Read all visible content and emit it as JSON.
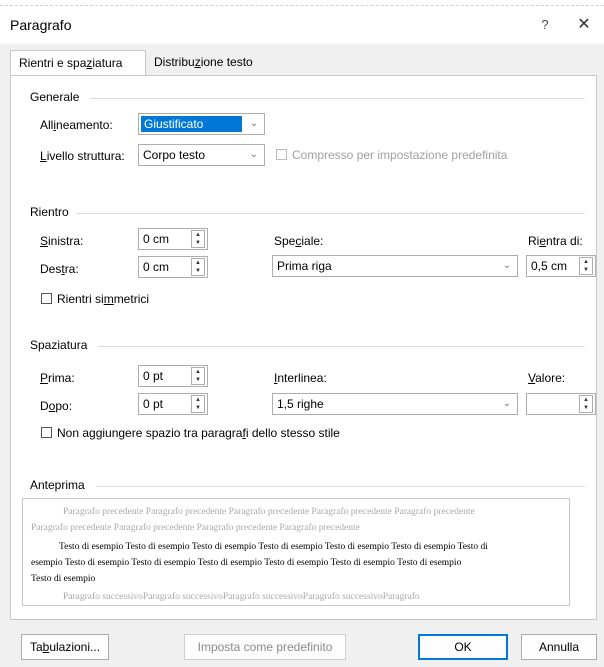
{
  "window": {
    "title": "Paragrafo",
    "help": "?",
    "close": "✕"
  },
  "tabs": [
    {
      "label_pre": "Rientri e spa",
      "label_u": "z",
      "label_post": "iatura"
    },
    {
      "label_pre": "Distribu",
      "label_u": "z",
      "label_post": "ione testo"
    }
  ],
  "generale": {
    "title": "Generale",
    "allineamento_pre": "All",
    "allineamento_u": "i",
    "allineamento_post": "neamento:",
    "allineamento_value": "Giustificato",
    "livello_u": "L",
    "livello_post": "ivello struttura:",
    "livello_value": "Corpo testo",
    "compresso": "Compresso per impostazione predefinita"
  },
  "rientro": {
    "title": "Rientro",
    "sinistra_u": "S",
    "sinistra_post": "inistra:",
    "sinistra_value": "0 cm",
    "destra_pre": "Des",
    "destra_u": "t",
    "destra_post": "ra:",
    "destra_value": "0 cm",
    "speciale_pre": "Spe",
    "speciale_u": "c",
    "speciale_post": "iale:",
    "speciale_value": "Prima riga",
    "rientradi_pre": "Ri",
    "rientradi_u": "e",
    "rientradi_post": "ntra di:",
    "rientradi_value": "0,5 cm",
    "simmetrici_pre": "Rientri si",
    "simmetrici_u": "m",
    "simmetrici_post": "metrici"
  },
  "spaziatura": {
    "title": "Spaziatura",
    "prima_u": "P",
    "prima_post": "rima:",
    "prima_value": "0 pt",
    "dopo_pre": "D",
    "dopo_u": "o",
    "dopo_post": "po:",
    "dopo_value": "0 pt",
    "interlinea_u": "I",
    "interlinea_post": "nterlinea:",
    "interlinea_value": "1,5 righe",
    "valore_u": "V",
    "valore_post": "alore:",
    "valore_value": "",
    "non_aggiungere_pre": "Non aggiungere spazio tra paragra",
    "non_aggiungere_u": "f",
    "non_aggiungere_post": "i dello stesso stile"
  },
  "anteprima": {
    "title": "Anteprima",
    "prev_1": "Paragrafo precedente Paragrafo precedente Paragrafo precedente Paragrafo precedente Paragrafo precedente",
    "prev_2": "Paragrafo precedente Paragrafo precedente Paragrafo precedente Paragrafo precedente",
    "sample_1": "Testo di esempio Testo di esempio Testo di esempio Testo di esempio Testo di esempio Testo di esempio Testo di",
    "sample_2": "esempio Testo di esempio Testo di esempio Testo di esempio Testo di esempio Testo di esempio Testo di esempio",
    "sample_3": "Testo di esempio",
    "next_1": "Paragrafo successivoParagrafo successivoParagrafo successivoParagrafo successivoParagrafo"
  },
  "buttons": {
    "tab_pre": "Ta",
    "tab_u": "b",
    "tab_post": "ulazioni...",
    "predefinito": "Imposta come predefinito",
    "ok": "OK",
    "annulla": "Annulla"
  },
  "colors": {
    "accent": "#0078d7"
  }
}
